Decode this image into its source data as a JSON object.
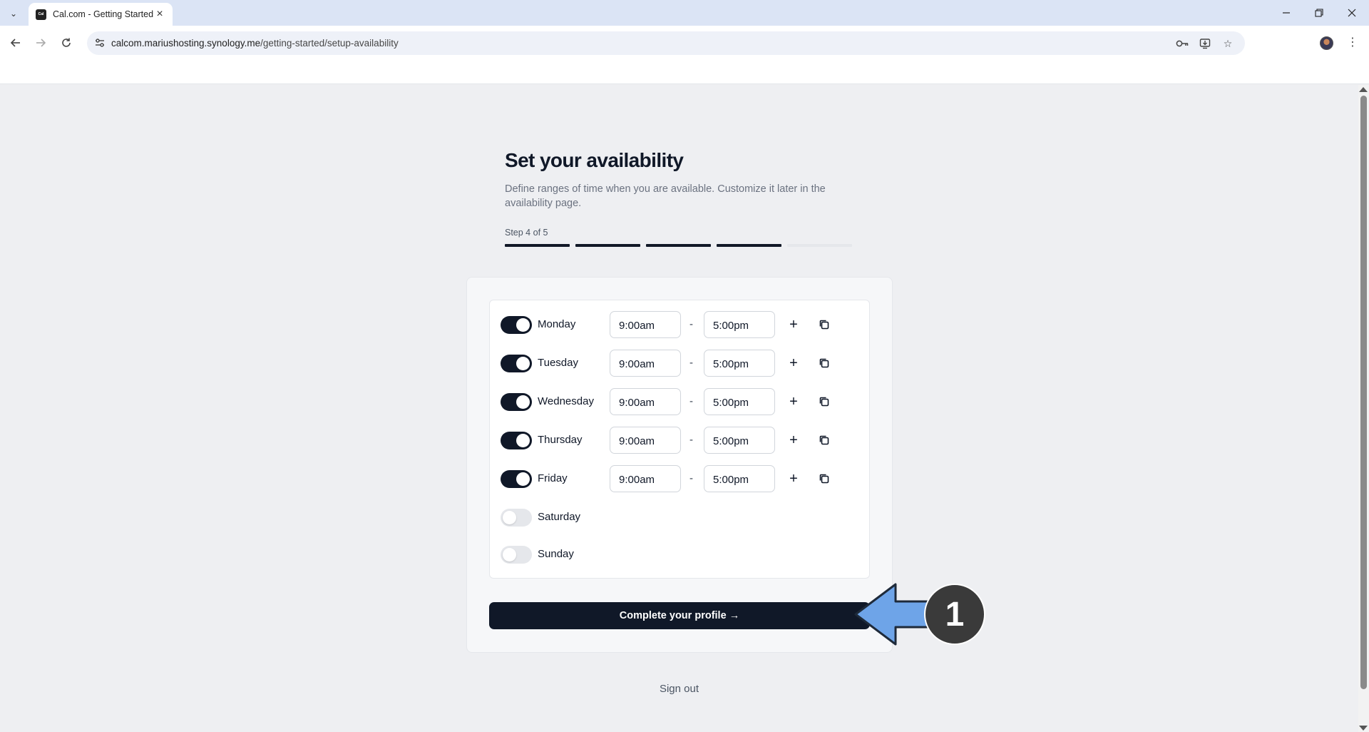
{
  "browser": {
    "tab_title": "Cal.com - Getting Started",
    "favicon_text": "Cal",
    "url_host": "calcom.mariushosting.synology.me",
    "url_path": "/getting-started/setup-availability"
  },
  "page": {
    "title": "Set your availability",
    "subtitle": "Define ranges of time when you are available. Customize it later in the availability page.",
    "step_label": "Step 4 of 5",
    "steps_total": 5,
    "steps_completed": 4,
    "schedule": [
      {
        "day": "Monday",
        "enabled": true,
        "from": "9:00am",
        "to": "5:00pm"
      },
      {
        "day": "Tuesday",
        "enabled": true,
        "from": "9:00am",
        "to": "5:00pm"
      },
      {
        "day": "Wednesday",
        "enabled": true,
        "from": "9:00am",
        "to": "5:00pm"
      },
      {
        "day": "Thursday",
        "enabled": true,
        "from": "9:00am",
        "to": "5:00pm"
      },
      {
        "day": "Friday",
        "enabled": true,
        "from": "9:00am",
        "to": "5:00pm"
      },
      {
        "day": "Saturday",
        "enabled": false
      },
      {
        "day": "Sunday",
        "enabled": false
      }
    ],
    "range_separator": "-",
    "cta_label": "Complete your profile",
    "cta_arrow": "→",
    "signout_label": "Sign out"
  },
  "annotation": {
    "number": "1",
    "arrow_color": "#6ea4e8",
    "badge_color": "#3a3a3a"
  },
  "colors": {
    "accent": "#101828",
    "page_bg": "#eeeff2"
  }
}
